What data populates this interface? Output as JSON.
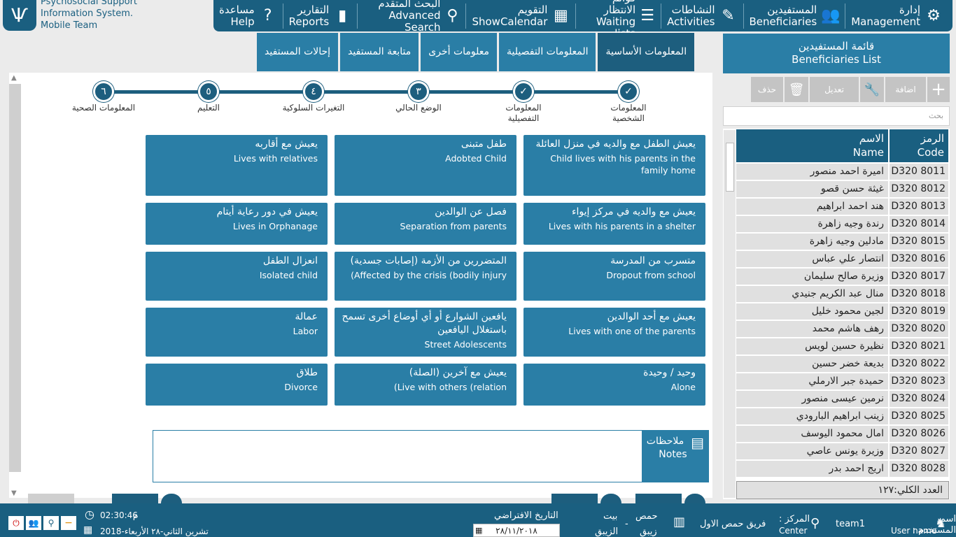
{
  "logo": {
    "line1": "Psychosocial Support",
    "line2": "Information System.",
    "line3": "Mobile Team",
    "icon": "logo-icon"
  },
  "nav": [
    {
      "ar": "إدارة",
      "en": "Management",
      "icon": "gear-icon",
      "glyph": "⚙"
    },
    {
      "ar": "المستفيدين",
      "en": "Beneficiaries",
      "icon": "users-icon",
      "glyph": "👥"
    },
    {
      "ar": "النشاطات",
      "en": "Activities",
      "icon": "edit-icon",
      "glyph": "✎"
    },
    {
      "ar": "قوائم الانتظار",
      "en": "Waiting lists",
      "icon": "list-icon",
      "glyph": "☰"
    },
    {
      "ar": "التقويم",
      "en": "ShowCalendar",
      "icon": "calendar-icon",
      "glyph": "▦"
    },
    {
      "ar": "البحث المتقدم",
      "en": "Advanced Search",
      "icon": "search-icon",
      "glyph": "⚲"
    },
    {
      "ar": "التقارير",
      "en": "Reports",
      "icon": "bar-chart-icon",
      "glyph": "▮"
    },
    {
      "ar": "مساعدة",
      "en": "Help",
      "icon": "help-icon",
      "glyph": "?"
    }
  ],
  "tabs": [
    "المعلومات الأساسية",
    "المعلومات التفصيلية",
    "معلومات أخرى",
    "متابعة المستفيد",
    "إحالات المستفيد"
  ],
  "steps": [
    {
      "mark": "✓",
      "label": "المعلومات\nالشخصية"
    },
    {
      "mark": "✓",
      "label": "المعلومات\nالتفصيلية"
    },
    {
      "mark": "٣",
      "label": "الوضع الحالي"
    },
    {
      "mark": "٤",
      "label": "التغيرات السلوكية"
    },
    {
      "mark": "٥",
      "label": "التعليم"
    },
    {
      "mark": "٦",
      "label": "المعلومات الصحية"
    }
  ],
  "cards": [
    [
      {
        "ar": "يعيش الطفل مع والديه في منزل العائلة",
        "en": "Child lives with his parents in the family home"
      },
      {
        "ar": "طفل متبنى",
        "en": "Adobted Child"
      },
      {
        "ar": "يعيش مع أقاربه",
        "en": "Lives with relatives"
      }
    ],
    [
      {
        "ar": "يعيش مع والديه في مركز إيواء",
        "en": "Lives with his parents in a shelter"
      },
      {
        "ar": "فصل عن الوالدين",
        "en": "Separation from parents"
      },
      {
        "ar": "يعيش في دور رعاية أيتام",
        "en": "Lives in Orphanage"
      }
    ],
    [
      {
        "ar": "متسرب من المدرسة",
        "en": "Dropout from school"
      },
      {
        "ar": "المتضررين من الأزمة (إصابات جسدية)",
        "en": "(Affected by the crisis (bodily injury"
      },
      {
        "ar": "انعزال الطفل",
        "en": "Isolated child"
      }
    ],
    [
      {
        "ar": "يعيش مع أحد الوالدين",
        "en": "Lives with one of the parents"
      },
      {
        "ar": "يافعين الشوارع أو أي أوضاع أخرى تسمح باستغلال اليافعين",
        "en": "Street Adolescents"
      },
      {
        "ar": "عمالة",
        "en": "Labor"
      }
    ],
    [
      {
        "ar": "وحيد / وحيدة",
        "en": "Alone"
      },
      {
        "ar": "يعيش مع آخرين (الصلة)",
        "en": "(Live with others (relation"
      },
      {
        "ar": "طلاق",
        "en": "Divorce"
      }
    ]
  ],
  "notes": {
    "ar": "ملاحظات",
    "en": "Notes",
    "icon": "notes-icon"
  },
  "sidebar": {
    "title_ar": "قائمة المستفيدين",
    "title_en": "Beneficiaries List",
    "toolbar": {
      "add": "اضافة",
      "edit": "تعديل",
      "delete": "حذف"
    },
    "search_placeholder": "بحث",
    "col_name_ar": "الاسم",
    "col_name_en": "Name",
    "col_code_ar": "الرمز",
    "col_code_en": "Code",
    "rows": [
      {
        "name": "اميرة احمد منصور",
        "code": "D320 8011"
      },
      {
        "name": "غيثة حسن قصو",
        "code": "D320 8012"
      },
      {
        "name": "هند احمد ابراهيم",
        "code": "D320 8013"
      },
      {
        "name": "رندة وجيه زاهرة",
        "code": "D320 8014"
      },
      {
        "name": "مادلين وجيه زاهرة",
        "code": "D320 8015"
      },
      {
        "name": "انتصار علي عباس",
        "code": "D320 8016"
      },
      {
        "name": "وزيرة صالح سليمان",
        "code": "D320 8017"
      },
      {
        "name": "منال عبد الكريم جنيدي",
        "code": "D320 8018"
      },
      {
        "name": "لجين محمود خليل",
        "code": "D320 8019"
      },
      {
        "name": "رهف هاشم محمد",
        "code": "D320 8020"
      },
      {
        "name": "نظيرة حسين لويس",
        "code": "D320 8021"
      },
      {
        "name": "بديعة خضر حسين",
        "code": "D320 8022"
      },
      {
        "name": "حميدة جبر الارملي",
        "code": "D320 8023"
      },
      {
        "name": "نرمين عيسى منصور",
        "code": "D320 8024"
      },
      {
        "name": "زينب ابراهيم البارودي",
        "code": "D320 8025"
      },
      {
        "name": "امال محمود اليوسف",
        "code": "D320 8026"
      },
      {
        "name": "وزيرة يونس عاصي",
        "code": "D320 8027"
      },
      {
        "name": "اريج احمد بدر",
        "code": "D320 8028"
      }
    ],
    "total": "العدد الكلي:١٢٧"
  },
  "status": {
    "user_label_ar": "اسم المستخدم :",
    "user_label_en": "User name",
    "user": "team1",
    "center_label_ar": "المركز :",
    "center_label_en": "Center",
    "center": "فريق حمص الاول",
    "city": "حمص",
    "city2": "زيبق",
    "sep": "-",
    "area": "بيت",
    "area2": "الزيبق",
    "default_date_label": "التاريخ الافتراضي",
    "default_date": "٢٨/١١/٢٠١٨",
    "time": "02:30:46",
    "ampm": "م",
    "date_long": "تشرين الثاني-٢٨ الأربعاء-2018"
  }
}
